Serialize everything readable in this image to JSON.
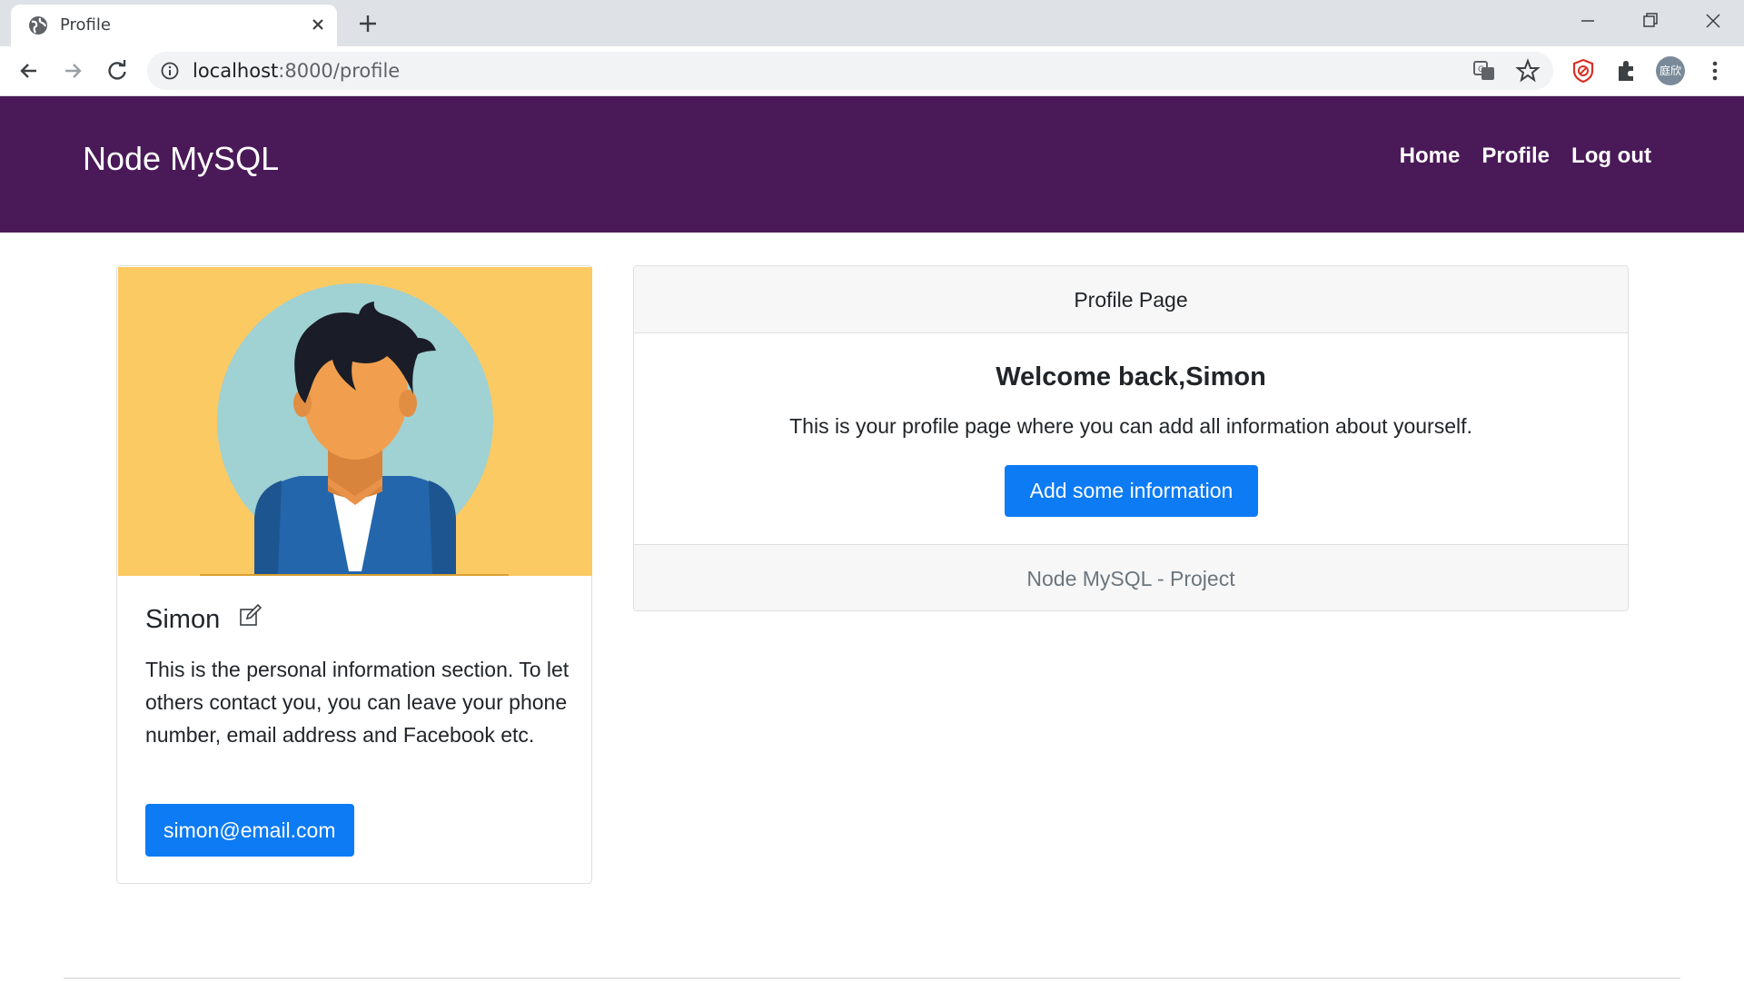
{
  "browser": {
    "tab_title": "Profile",
    "url_host": "localhost",
    "url_path": ":8000/profile",
    "avatar_text": "庭欣"
  },
  "navbar": {
    "brand": "Node MySQL",
    "links": [
      "Home",
      "Profile",
      "Log out"
    ],
    "bg_color": "#4a1a58"
  },
  "profile_card": {
    "name": "Simon",
    "description": "This is the personal information section. To let others contact you, you can leave your phone number, email address and Facebook etc.",
    "email_button": "simon@email.com",
    "illustration_bg": "#fbca63"
  },
  "main_card": {
    "header": "Profile Page",
    "welcome": "Welcome back,Simon",
    "description": "This is your profile page where you can add all information about yourself.",
    "button": "Add some information",
    "footer": "Node MySQL - Project",
    "accent": "#0d7bf3"
  }
}
